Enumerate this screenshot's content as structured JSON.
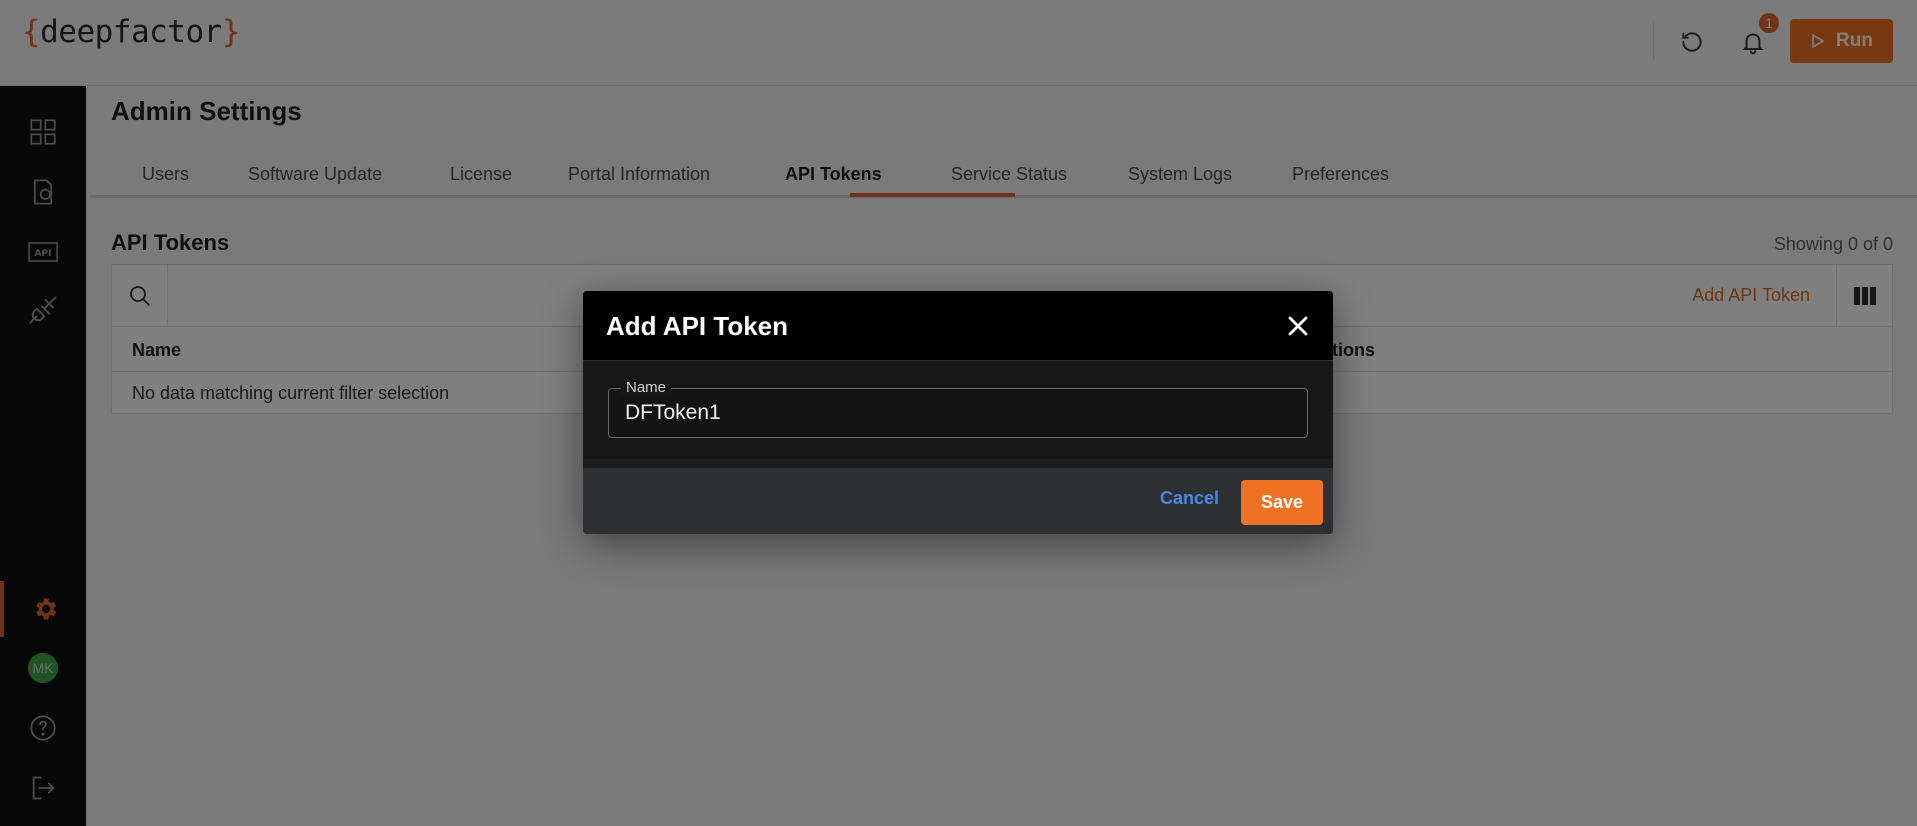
{
  "header": {
    "logo_open": "{",
    "logo_text": "deepfactor",
    "logo_close": "}",
    "notification_count": "1",
    "run_label": "Run"
  },
  "sidebar": {
    "avatar_initials": "MK",
    "items": [
      {
        "icon": "dashboard-grid-icon"
      },
      {
        "icon": "document-shield-icon"
      },
      {
        "icon": "api-icon"
      },
      {
        "icon": "plug-icon"
      },
      {
        "icon": "gear-icon",
        "active": true
      },
      {
        "icon": "avatar"
      },
      {
        "icon": "help-icon"
      },
      {
        "icon": "logout-icon"
      }
    ]
  },
  "page": {
    "title": "Admin Settings",
    "tabs": [
      {
        "label": "Users"
      },
      {
        "label": "Software Update"
      },
      {
        "label": "License"
      },
      {
        "label": "Portal Information"
      },
      {
        "label": "API Tokens",
        "active": true
      },
      {
        "label": "Service Status"
      },
      {
        "label": "System Logs"
      },
      {
        "label": "Preferences"
      }
    ]
  },
  "tokens": {
    "section_title": "API Tokens",
    "showing": "Showing 0 of 0",
    "add_label": "Add API Token",
    "columns": [
      "Name",
      "ctions"
    ],
    "empty_message": "No data matching current filter selection"
  },
  "modal": {
    "title": "Add API Token",
    "field_label": "Name",
    "field_value": "DFToken1",
    "cancel_label": "Cancel",
    "save_label": "Save"
  },
  "colors": {
    "accent": "#f07124",
    "sidebar_bg": "#101010",
    "link_blue": "#4a86e8"
  }
}
